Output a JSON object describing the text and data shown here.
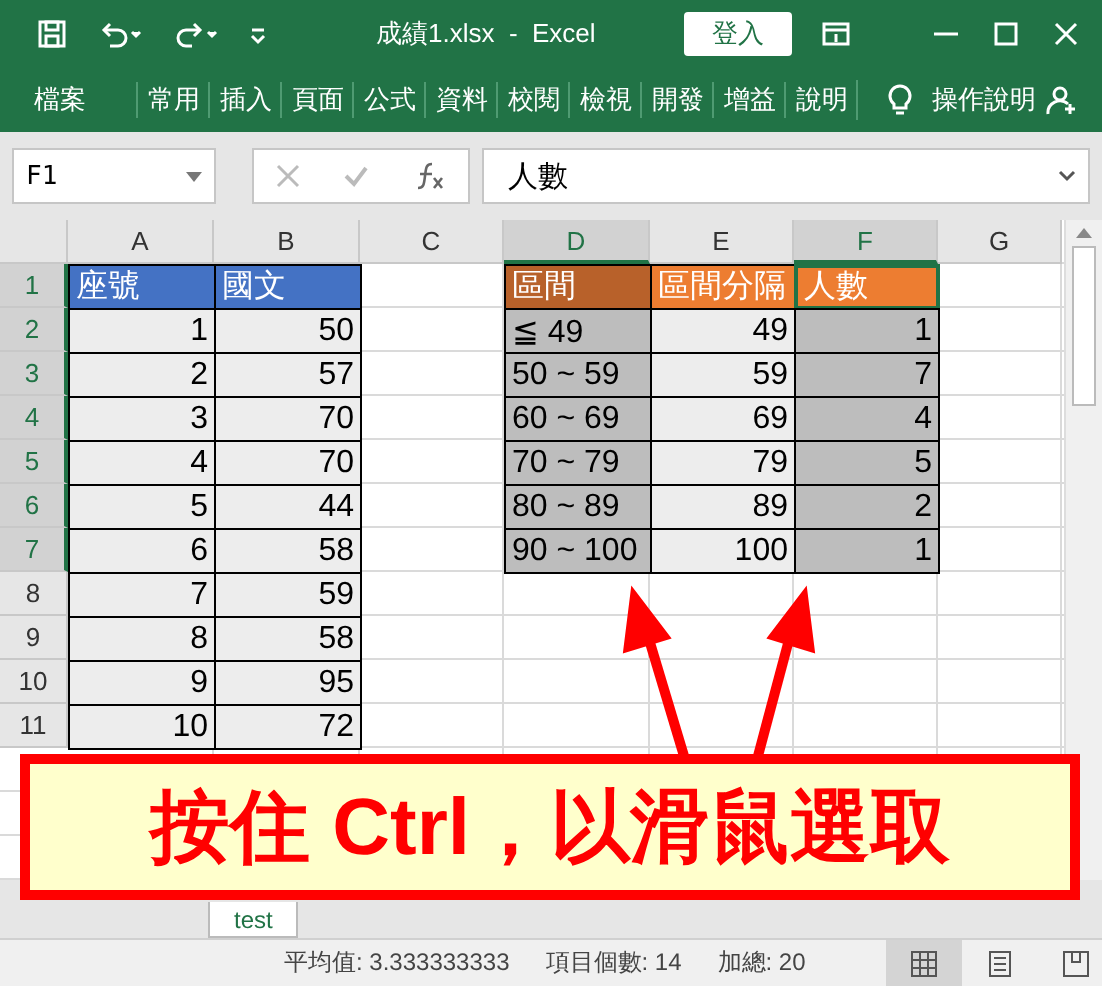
{
  "window": {
    "title": "成績1.xlsx  -  Excel",
    "sign_in": "登入"
  },
  "ribbon": {
    "file_tab": "檔案",
    "tabs": [
      "常用",
      "插入",
      "頁面",
      "公式",
      "資料",
      "校閱",
      "檢視",
      "開發",
      "增益",
      "說明"
    ],
    "tell_me": "操作說明"
  },
  "formula_bar": {
    "name_box": "F1",
    "value": "人數"
  },
  "sheet": {
    "columns": [
      {
        "label": "A",
        "selected": false
      },
      {
        "label": "B",
        "selected": false
      },
      {
        "label": "C",
        "selected": false
      },
      {
        "label": "D",
        "selected": true
      },
      {
        "label": "E",
        "selected": false
      },
      {
        "label": "F",
        "selected": true
      },
      {
        "label": "G",
        "selected": false
      }
    ],
    "rows": [
      {
        "header": "1",
        "selected": true,
        "cells": [
          {
            "text": "座號",
            "kind": "blue-header"
          },
          {
            "text": "國文",
            "kind": "blue-header"
          },
          {
            "kind": "empty"
          },
          {
            "text": "區間",
            "kind": "brown-header"
          },
          {
            "text": "區間分隔",
            "kind": "orange-header"
          },
          {
            "text": "人數",
            "kind": "active-header"
          },
          {
            "kind": "empty"
          }
        ]
      },
      {
        "header": "2",
        "selected": true,
        "cells": [
          {
            "text": "1",
            "kind": "number"
          },
          {
            "text": "50",
            "kind": "number"
          },
          {
            "kind": "empty"
          },
          {
            "text": "≦ 49",
            "kind": "selected-label"
          },
          {
            "text": "49",
            "kind": "number"
          },
          {
            "text": "1",
            "kind": "selected-number"
          },
          {
            "kind": "empty"
          }
        ]
      },
      {
        "header": "3",
        "selected": true,
        "cells": [
          {
            "text": "2",
            "kind": "number"
          },
          {
            "text": "57",
            "kind": "number"
          },
          {
            "kind": "empty"
          },
          {
            "text": "50 ~ 59",
            "kind": "selected-label"
          },
          {
            "text": "59",
            "kind": "number"
          },
          {
            "text": "7",
            "kind": "selected-number"
          },
          {
            "kind": "empty"
          }
        ]
      },
      {
        "header": "4",
        "selected": true,
        "cells": [
          {
            "text": "3",
            "kind": "number"
          },
          {
            "text": "70",
            "kind": "number"
          },
          {
            "kind": "empty"
          },
          {
            "text": "60 ~ 69",
            "kind": "selected-label"
          },
          {
            "text": "69",
            "kind": "number"
          },
          {
            "text": "4",
            "kind": "selected-number"
          },
          {
            "kind": "empty"
          }
        ]
      },
      {
        "header": "5",
        "selected": true,
        "cells": [
          {
            "text": "4",
            "kind": "number"
          },
          {
            "text": "70",
            "kind": "number"
          },
          {
            "kind": "empty"
          },
          {
            "text": "70 ~ 79",
            "kind": "selected-label"
          },
          {
            "text": "79",
            "kind": "number"
          },
          {
            "text": "5",
            "kind": "selected-number"
          },
          {
            "kind": "empty"
          }
        ]
      },
      {
        "header": "6",
        "selected": true,
        "cells": [
          {
            "text": "5",
            "kind": "number"
          },
          {
            "text": "44",
            "kind": "number"
          },
          {
            "kind": "empty"
          },
          {
            "text": "80 ~ 89",
            "kind": "selected-label"
          },
          {
            "text": "89",
            "kind": "number"
          },
          {
            "text": "2",
            "kind": "selected-number"
          },
          {
            "kind": "empty"
          }
        ]
      },
      {
        "header": "7",
        "selected": true,
        "cells": [
          {
            "text": "6",
            "kind": "number"
          },
          {
            "text": "58",
            "kind": "number"
          },
          {
            "kind": "empty"
          },
          {
            "text": "90 ~ 100",
            "kind": "selected-label"
          },
          {
            "text": "100",
            "kind": "number"
          },
          {
            "text": "1",
            "kind": "selected-number"
          },
          {
            "kind": "empty"
          }
        ]
      },
      {
        "header": "8",
        "selected": false,
        "cells": [
          {
            "text": "7",
            "kind": "number"
          },
          {
            "text": "59",
            "kind": "number"
          },
          {
            "kind": "empty"
          },
          {
            "kind": "empty"
          },
          {
            "kind": "empty"
          },
          {
            "kind": "empty"
          },
          {
            "kind": "empty"
          }
        ]
      },
      {
        "header": "9",
        "selected": false,
        "cells": [
          {
            "text": "8",
            "kind": "number"
          },
          {
            "text": "58",
            "kind": "number"
          },
          {
            "kind": "empty"
          },
          {
            "kind": "empty"
          },
          {
            "kind": "empty"
          },
          {
            "kind": "empty"
          },
          {
            "kind": "empty"
          }
        ]
      },
      {
        "header": "10",
        "selected": false,
        "cells": [
          {
            "text": "9",
            "kind": "number"
          },
          {
            "text": "95",
            "kind": "number"
          },
          {
            "kind": "empty"
          },
          {
            "kind": "empty"
          },
          {
            "kind": "empty"
          },
          {
            "kind": "empty"
          },
          {
            "kind": "empty"
          }
        ]
      },
      {
        "header": "11",
        "selected": false,
        "cells": [
          {
            "text": "10",
            "kind": "number"
          },
          {
            "text": "72",
            "kind": "number"
          },
          {
            "kind": "empty"
          },
          {
            "kind": "empty"
          },
          {
            "kind": "empty"
          },
          {
            "kind": "empty"
          },
          {
            "kind": "empty"
          }
        ]
      }
    ]
  },
  "sheet_tabs": [
    {
      "label": "test",
      "selected": true
    }
  ],
  "callout": "按住 Ctrl，以滑鼠選取",
  "status_bar": {
    "items": [
      "平均值: 3.333333333",
      "項目個數: 14",
      "加總: 20"
    ],
    "views": [
      {
        "selected": true
      },
      {
        "selected": false
      },
      {
        "selected": false
      }
    ]
  }
}
